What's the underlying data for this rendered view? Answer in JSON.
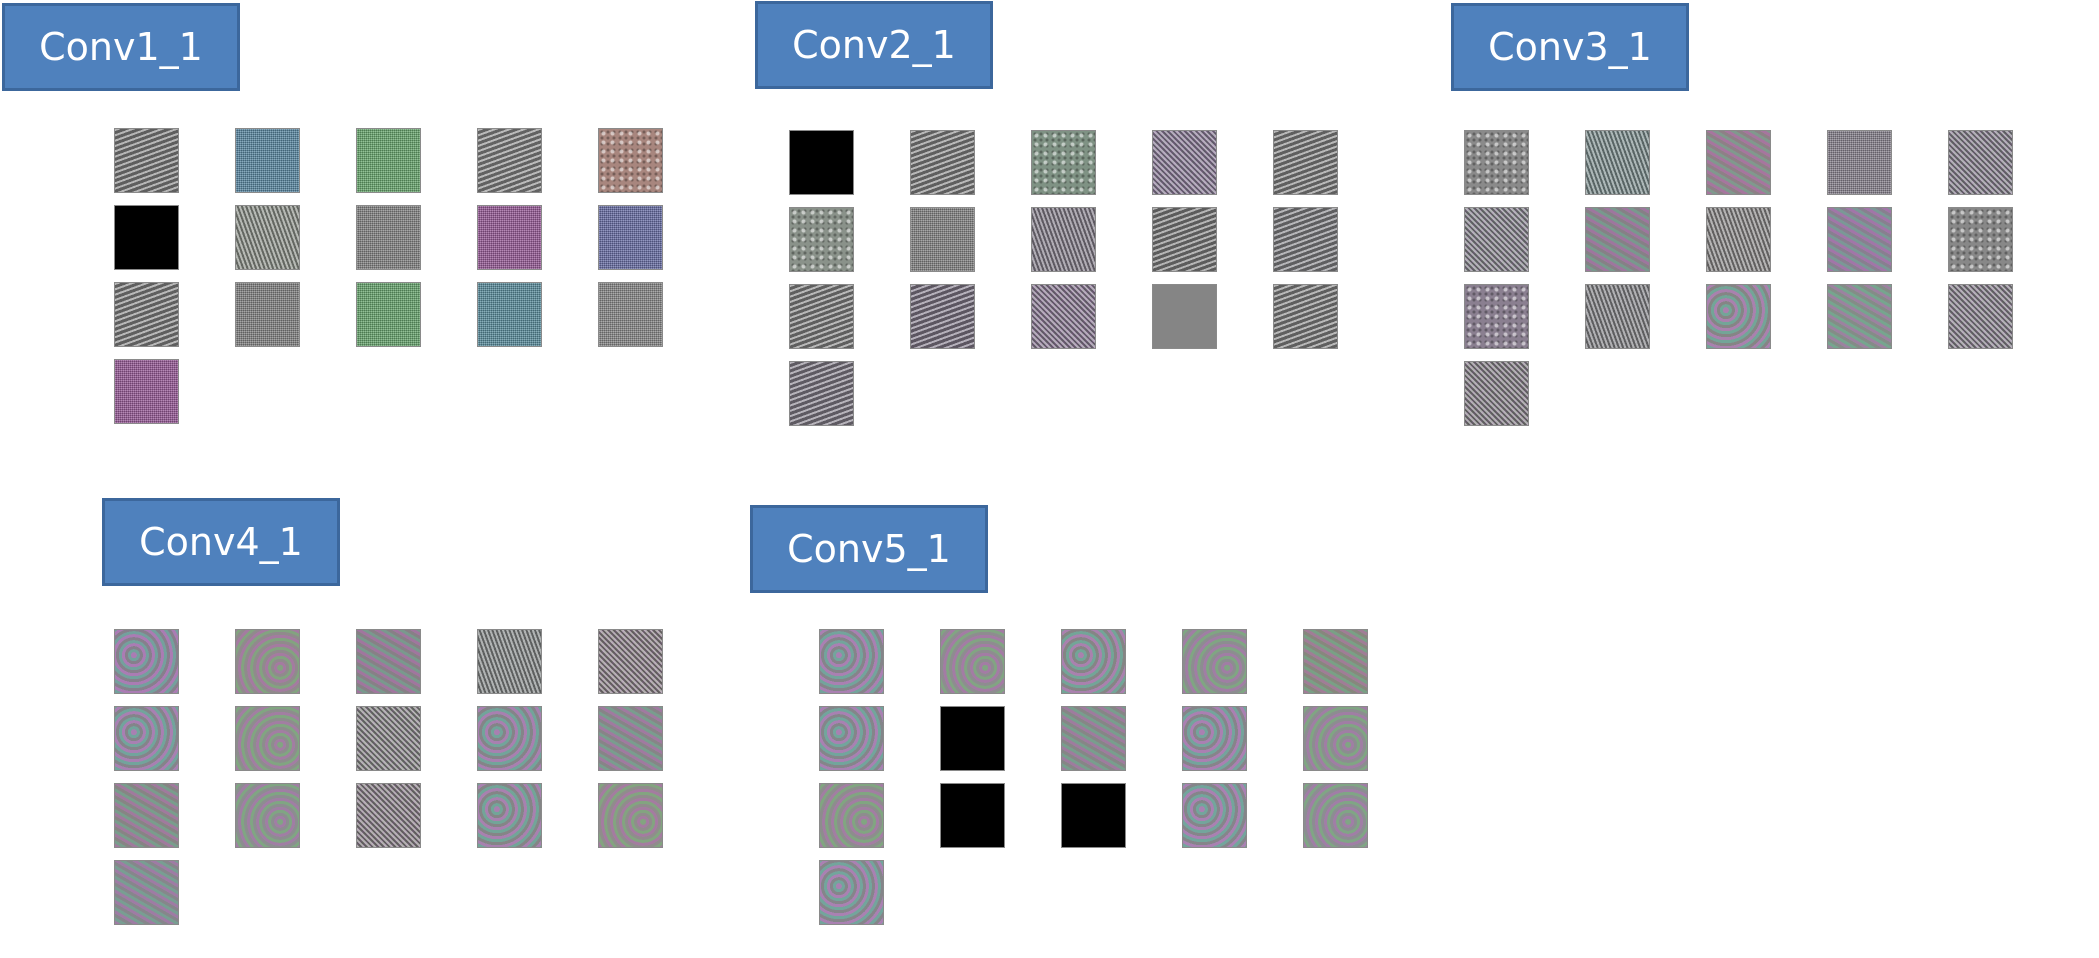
{
  "panels": [
    {
      "label": "Conv1_1",
      "tiles": [
        {
          "color": "#8a8a8a",
          "pattern": "wave"
        },
        {
          "color": "#5b8aa6",
          "pattern": "fine"
        },
        {
          "color": "#6aaa70",
          "pattern": "fine"
        },
        {
          "color": "#909090",
          "pattern": "wave"
        },
        {
          "color": "#a8867e",
          "pattern": "dots"
        },
        {
          "color": "#000000",
          "pattern": "none"
        },
        {
          "color": "#8f948c",
          "pattern": "wave2"
        },
        {
          "color": "#868686",
          "pattern": "fine"
        },
        {
          "color": "#9a5c9a",
          "pattern": "fine"
        },
        {
          "color": "#6a70a8",
          "pattern": "fine"
        },
        {
          "color": "#8c8c8c",
          "pattern": "wave"
        },
        {
          "color": "#858585",
          "pattern": "fine"
        },
        {
          "color": "#68a870",
          "pattern": "fine"
        },
        {
          "color": "#5a8fa0",
          "pattern": "fine"
        },
        {
          "color": "#8a8a8a",
          "pattern": "fine"
        },
        {
          "color": "#9a5c9a",
          "pattern": "fine"
        }
      ]
    },
    {
      "label": "Conv2_1",
      "tiles": [
        {
          "color": "#000000",
          "pattern": "none"
        },
        {
          "color": "#8c8c8c",
          "pattern": "wave"
        },
        {
          "color": "#7f9284",
          "pattern": "dots"
        },
        {
          "color": "#8a8196",
          "pattern": "diag"
        },
        {
          "color": "#8c8c8c",
          "pattern": "wave"
        },
        {
          "color": "#8a928a",
          "pattern": "dots"
        },
        {
          "color": "#868686",
          "pattern": "fine"
        },
        {
          "color": "#86808c",
          "pattern": "wave2"
        },
        {
          "color": "#888888",
          "pattern": "wave"
        },
        {
          "color": "#8a8a8e",
          "pattern": "wave"
        },
        {
          "color": "#8c8c8c",
          "pattern": "wave"
        },
        {
          "color": "#877f8f",
          "pattern": "wave"
        },
        {
          "color": "#8a7f92",
          "pattern": "diag"
        },
        {
          "color": "#858585",
          "pattern": "none"
        },
        {
          "color": "#8c8c8c",
          "pattern": "wave"
        },
        {
          "color": "#8a8490",
          "pattern": "wave"
        }
      ]
    },
    {
      "label": "Conv3_1",
      "tiles": [
        {
          "color": "#8a8a8a",
          "pattern": "dots"
        },
        {
          "color": "#7f9090",
          "pattern": "wave2"
        },
        {
          "color": "#948088",
          "pattern": "check"
        },
        {
          "color": "#8a8490",
          "pattern": "fine"
        },
        {
          "color": "#86868c",
          "pattern": "diag"
        },
        {
          "color": "#868a8c",
          "pattern": "diag"
        },
        {
          "color": "#888088",
          "pattern": "check"
        },
        {
          "color": "#8c8a8a",
          "pattern": "wave2"
        },
        {
          "color": "#8c7f96",
          "pattern": "check"
        },
        {
          "color": "#888888",
          "pattern": "dots"
        },
        {
          "color": "#8a7f90",
          "pattern": "dots"
        },
        {
          "color": "#86868a",
          "pattern": "wave2"
        },
        {
          "color": "#888888",
          "pattern": "swirl"
        },
        {
          "color": "#85928a",
          "pattern": "check"
        },
        {
          "color": "#88888c",
          "pattern": "diag"
        },
        {
          "color": "#868686",
          "pattern": "diag"
        }
      ]
    },
    {
      "label": "Conv4_1",
      "tiles": [
        {
          "color": "#8a7f92",
          "pattern": "swirl"
        },
        {
          "color": "#8c8486",
          "pattern": "swirl2"
        },
        {
          "color": "#8a8088",
          "pattern": "check"
        },
        {
          "color": "#868a8a",
          "pattern": "wave2"
        },
        {
          "color": "#8c8686",
          "pattern": "diag"
        },
        {
          "color": "#868690",
          "pattern": "swirl"
        },
        {
          "color": "#888888",
          "pattern": "swirl2"
        },
        {
          "color": "#888c86",
          "pattern": "diag"
        },
        {
          "color": "#86868c",
          "pattern": "swirl"
        },
        {
          "color": "#8a868a",
          "pattern": "check"
        },
        {
          "color": "#8a8686",
          "pattern": "check"
        },
        {
          "color": "#86888c",
          "pattern": "swirl2"
        },
        {
          "color": "#8a8686",
          "pattern": "diag"
        },
        {
          "color": "#86888a",
          "pattern": "swirl"
        },
        {
          "color": "#8c8686",
          "pattern": "swirl2"
        },
        {
          "color": "#888890",
          "pattern": "check"
        }
      ]
    },
    {
      "label": "Conv5_1",
      "tiles": [
        {
          "color": "#888690",
          "pattern": "swirl"
        },
        {
          "color": "#8a868c",
          "pattern": "swirl2"
        },
        {
          "color": "#888888",
          "pattern": "swirl"
        },
        {
          "color": "#86888c",
          "pattern": "swirl2"
        },
        {
          "color": "#8a8a7c",
          "pattern": "check"
        },
        {
          "color": "#868890",
          "pattern": "swirl"
        },
        {
          "color": "#000000",
          "pattern": "none"
        },
        {
          "color": "#888888",
          "pattern": "check"
        },
        {
          "color": "#8a8690",
          "pattern": "swirl"
        },
        {
          "color": "#86888c",
          "pattern": "swirl2"
        },
        {
          "color": "#888888",
          "pattern": "swirl2"
        },
        {
          "color": "#000000",
          "pattern": "none"
        },
        {
          "color": "#000000",
          "pattern": "none"
        },
        {
          "color": "#888890",
          "pattern": "swirl"
        },
        {
          "color": "#868890",
          "pattern": "swirl2"
        },
        {
          "color": "#888890",
          "pattern": "swirl"
        }
      ]
    }
  ]
}
